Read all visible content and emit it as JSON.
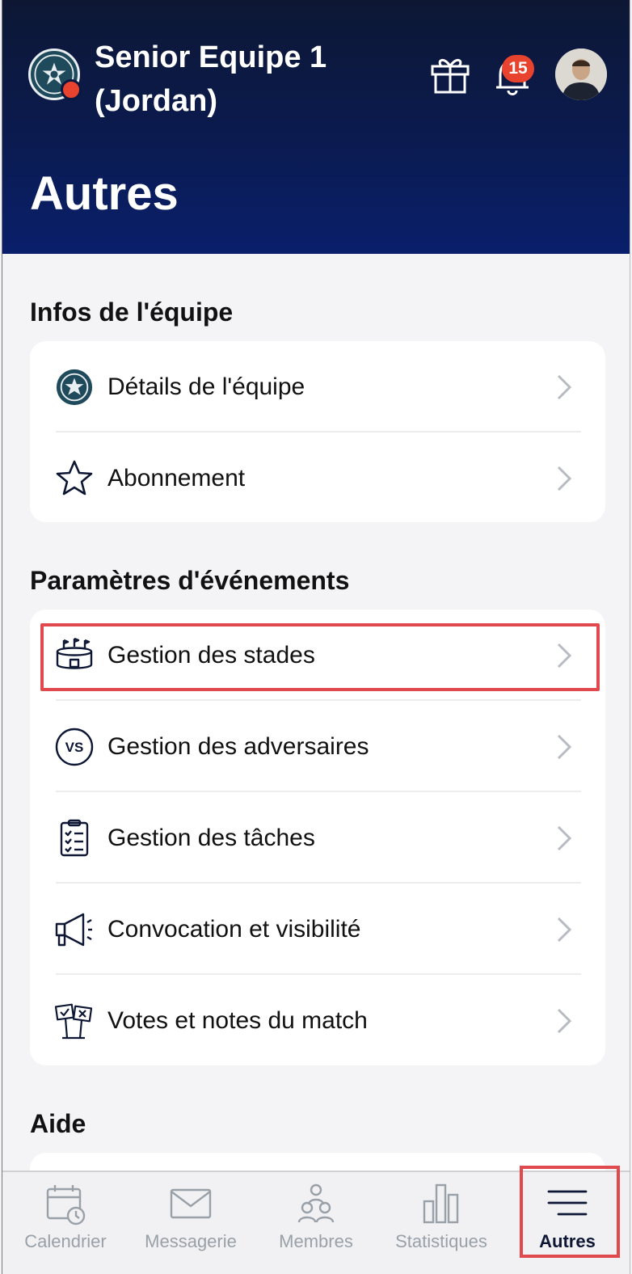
{
  "header": {
    "team_name": "Senior Equipe 1 (Jordan)",
    "notification_count": "15",
    "page_title": "Autres"
  },
  "sections": [
    {
      "title": "Infos de l'équipe",
      "items": [
        {
          "label": "Détails de l'équipe",
          "icon": "team-logo-icon"
        },
        {
          "label": "Abonnement",
          "icon": "star-icon"
        }
      ]
    },
    {
      "title": "Paramètres d'événements",
      "items": [
        {
          "label": "Gestion des stades",
          "icon": "stadium-icon"
        },
        {
          "label": "Gestion des adversaires",
          "icon": "vs-icon"
        },
        {
          "label": "Gestion des tâches",
          "icon": "checklist-icon"
        },
        {
          "label": "Convocation et visibilité",
          "icon": "megaphone-icon"
        },
        {
          "label": "Votes et notes du match",
          "icon": "vote-signs-icon"
        }
      ]
    },
    {
      "title": "Aide",
      "items": []
    }
  ],
  "bottom_nav": [
    {
      "label": "Calendrier",
      "icon": "calendar-icon",
      "active": false
    },
    {
      "label": "Messagerie",
      "icon": "mail-icon",
      "active": false
    },
    {
      "label": "Membres",
      "icon": "members-icon",
      "active": false
    },
    {
      "label": "Statistiques",
      "icon": "stats-icon",
      "active": false
    },
    {
      "label": "Autres",
      "icon": "menu-icon",
      "active": true
    }
  ],
  "colors": {
    "header_top": "#0d1734",
    "header_bottom": "#0a1f6b",
    "badge": "#e8432e",
    "highlight": "#e04a4f"
  }
}
